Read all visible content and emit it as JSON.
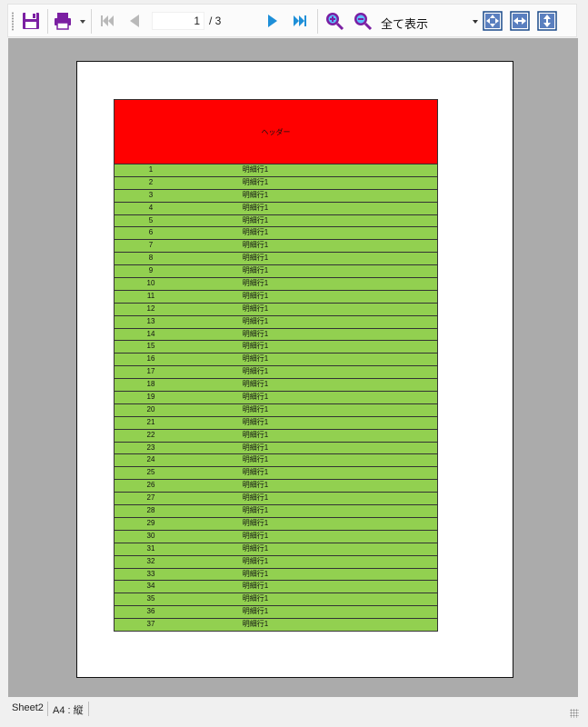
{
  "toolbar": {
    "page_current": "1",
    "page_total": "/ 3",
    "zoom_value": "全て表示",
    "icons": [
      "save-icon",
      "print-icon",
      "first-page-icon",
      "prev-page-icon",
      "next-page-icon",
      "last-page-icon",
      "zoom-in-icon",
      "zoom-out-icon",
      "fit-page-icon",
      "fit-width-icon",
      "fit-height-icon"
    ]
  },
  "sheet": {
    "header_label": "ヘッダー",
    "row_label": "明細行1",
    "row_numbers": [
      "1",
      "2",
      "3",
      "4",
      "5",
      "6",
      "7",
      "8",
      "9",
      "10",
      "11",
      "12",
      "13",
      "14",
      "15",
      "16",
      "17",
      "18",
      "19",
      "20",
      "21",
      "22",
      "23",
      "24",
      "25",
      "26",
      "27",
      "28",
      "29",
      "30",
      "31",
      "32",
      "33",
      "34",
      "35",
      "36",
      "37"
    ],
    "colors": {
      "header": "#ff0000",
      "row": "#92d050"
    }
  },
  "status": {
    "sheet_name": "Sheet2",
    "paper": "A4 : 縦"
  }
}
